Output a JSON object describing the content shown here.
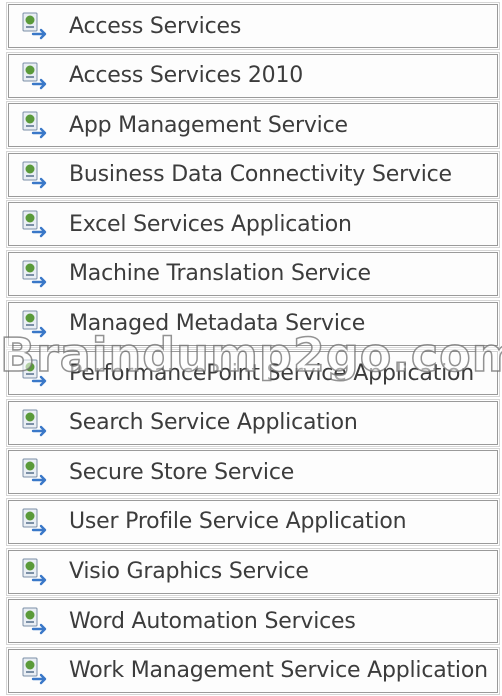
{
  "service_list": {
    "items": [
      {
        "label": "Access Services",
        "icon": "service-application-icon"
      },
      {
        "label": "Access Services 2010",
        "icon": "service-application-icon"
      },
      {
        "label": "App Management Service",
        "icon": "service-application-icon"
      },
      {
        "label": "Business Data Connectivity Service",
        "icon": "service-application-icon"
      },
      {
        "label": "Excel Services Application",
        "icon": "service-application-icon"
      },
      {
        "label": "Machine Translation Service",
        "icon": "service-application-icon"
      },
      {
        "label": "Managed Metadata Service",
        "icon": "service-application-icon"
      },
      {
        "label": "PerformancePoint Service Application",
        "icon": "service-application-icon"
      },
      {
        "label": "Search Service Application",
        "icon": "service-application-icon"
      },
      {
        "label": "Secure Store Service",
        "icon": "service-application-icon"
      },
      {
        "label": "User Profile Service Application",
        "icon": "service-application-icon"
      },
      {
        "label": "Visio Graphics Service",
        "icon": "service-application-icon"
      },
      {
        "label": "Word Automation Services",
        "icon": "service-application-icon"
      },
      {
        "label": "Work Management Service Application",
        "icon": "service-application-icon"
      }
    ]
  },
  "watermark": {
    "text": "Braindump2go.com"
  },
  "colors": {
    "border": "#9a9a9a",
    "text": "#3c3c3c",
    "icon_green": "#5a9a3a",
    "icon_blue": "#3a78c8"
  }
}
